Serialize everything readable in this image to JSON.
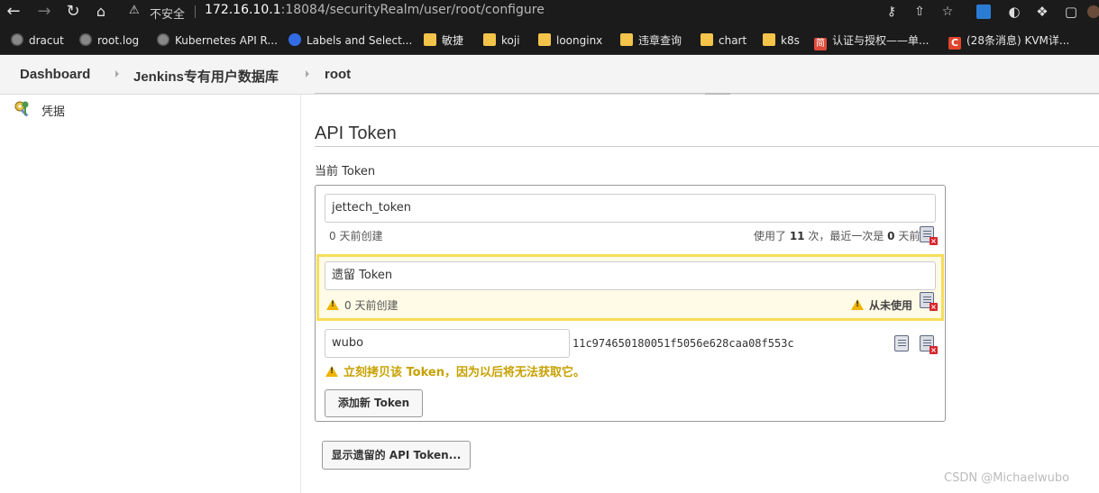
{
  "browser": {
    "security_label": "不安全",
    "url_host": "172.16.10.1",
    "url_rest": ":18084/securityRealm/user/root/configure",
    "bookmarks": [
      {
        "label": "dracut",
        "icon": "globe-icon"
      },
      {
        "label": "root.log",
        "icon": "globe-icon"
      },
      {
        "label": "Kubernetes API R...",
        "icon": "globe-icon"
      },
      {
        "label": "Labels and Select...",
        "icon": "kubernetes-icon"
      },
      {
        "label": "敏捷",
        "icon": "folder-icon"
      },
      {
        "label": "koji",
        "icon": "folder-icon"
      },
      {
        "label": "loonginx",
        "icon": "folder-icon"
      },
      {
        "label": "违章查询",
        "icon": "folder-icon"
      },
      {
        "label": "chart",
        "icon": "folder-icon"
      },
      {
        "label": "k8s",
        "icon": "folder-icon"
      },
      {
        "label": "认证与授权——单...",
        "icon": "jianshu-icon",
        "glyph": "简"
      },
      {
        "label": "(28条消息) KVM详...",
        "icon": "csdn-icon",
        "glyph": "C"
      }
    ]
  },
  "breadcrumb": [
    "Dashboard",
    "Jenkins专有用户数据库",
    "root"
  ],
  "sidebar": {
    "items": [
      {
        "label": "凭据",
        "icon": "credentials-keys-icon"
      }
    ]
  },
  "api_token": {
    "title": "API Token",
    "current_label": "当前 Token",
    "tokens": [
      {
        "name": "jettech_token",
        "created": "0 天前创建",
        "usage_prefix": "使用了 ",
        "usage_count": "11",
        "usage_mid": " 次，最近一次是 ",
        "usage_days": "0",
        "usage_suffix": " 天前"
      },
      {
        "name": "遗留 Token",
        "created": "0 天前创建",
        "usage": "从未使用"
      }
    ],
    "new_token": {
      "name": "wubo",
      "value": "11c974650180051f5056e628caa08f553c",
      "warning": "立刻拷贝该 Token，因为以后将无法获取它。"
    },
    "add_button": "添加新 Token",
    "show_legacy_button": "显示遗留的 API Token..."
  },
  "watermark": "CSDN @Michaelwubo",
  "colors": {
    "warning": "#c7a100",
    "legacy_bg": "#fffbe6",
    "legacy_border": "#f7dd5a"
  }
}
